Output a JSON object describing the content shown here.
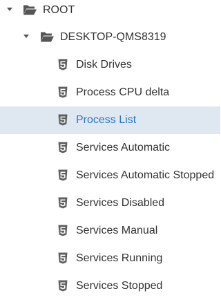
{
  "tree": {
    "root": {
      "label": "ROOT",
      "expanded": true,
      "icon": "folder-open-icon"
    },
    "host": {
      "label": "DESKTOP-QMS8319",
      "expanded": true,
      "icon": "folder-open-icon"
    },
    "items": [
      {
        "label": "Disk Drives",
        "icon": "html5-file-icon",
        "selected": false
      },
      {
        "label": "Process CPU delta",
        "icon": "html5-file-icon",
        "selected": false
      },
      {
        "label": "Process List",
        "icon": "html5-file-icon",
        "selected": true
      },
      {
        "label": "Services Automatic",
        "icon": "html5-file-icon",
        "selected": false
      },
      {
        "label": "Services Automatic Stopped",
        "icon": "html5-file-icon",
        "selected": false
      },
      {
        "label": "Services Disabled",
        "icon": "html5-file-icon",
        "selected": false
      },
      {
        "label": "Services Manual",
        "icon": "html5-file-icon",
        "selected": false
      },
      {
        "label": "Services Running",
        "icon": "html5-file-icon",
        "selected": false
      },
      {
        "label": "Services Stopped",
        "icon": "html5-file-icon",
        "selected": false
      }
    ],
    "colors": {
      "selected_background": "#dfe8f1",
      "selected_text": "#2b78c5",
      "text": "#333333",
      "icon": "#555555"
    }
  }
}
